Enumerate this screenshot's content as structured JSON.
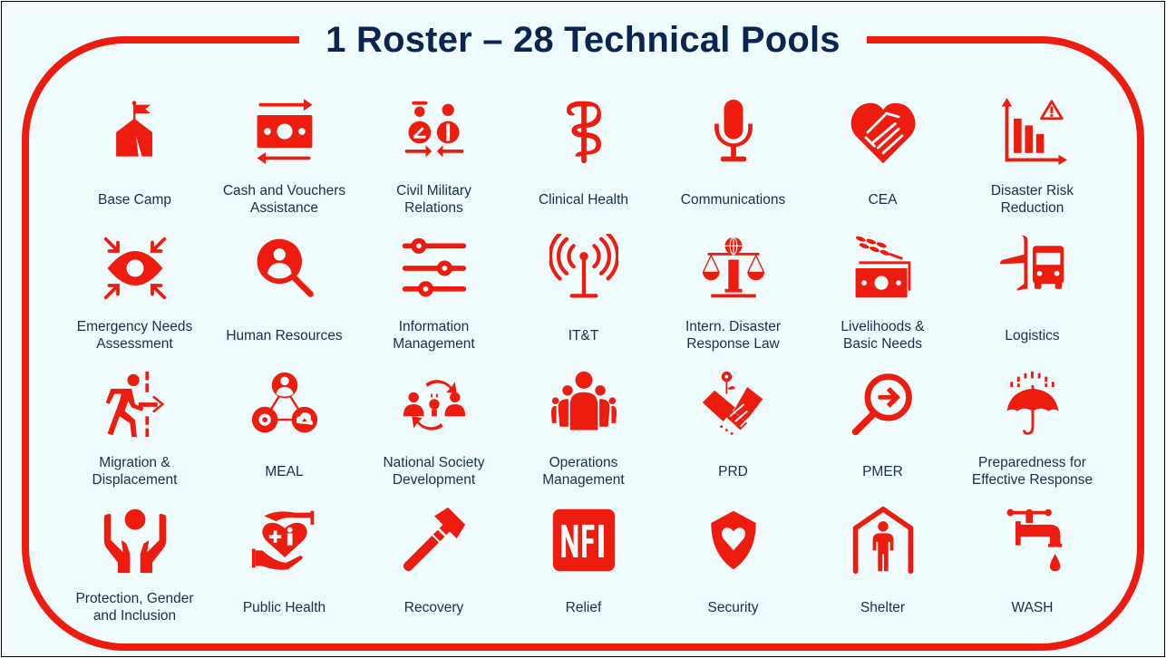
{
  "title": "1 Roster – 28 Technical Pools",
  "colors": {
    "accent": "#EE1C0E",
    "title": "#0C2550",
    "label": "#1B2D4F",
    "background": "#F0FCFE"
  },
  "pools": [
    {
      "label": "Base Camp",
      "icon": "tent-flag-icon"
    },
    {
      "label": "Cash and Vouchers\nAssistance",
      "icon": "cash-transfer-icon"
    },
    {
      "label": "Civil Military\nRelations",
      "icon": "civil-military-icon"
    },
    {
      "label": "Clinical Health",
      "icon": "caduceus-icon"
    },
    {
      "label": "Communications",
      "icon": "microphone-icon"
    },
    {
      "label": "CEA",
      "icon": "heart-handshake-icon"
    },
    {
      "label": "Disaster Risk\nReduction",
      "icon": "chart-warning-icon"
    },
    {
      "label": "Emergency Needs\nAssessment",
      "icon": "eye-focus-icon"
    },
    {
      "label": "Human  Resources",
      "icon": "person-search-icon"
    },
    {
      "label": "Information\nManagement",
      "icon": "sliders-icon"
    },
    {
      "label": "IT&T",
      "icon": "antenna-icon"
    },
    {
      "label": "Intern.  Disaster\nResponse Law",
      "icon": "scales-globe-icon"
    },
    {
      "label": "Livelihoods &\nBasic Needs",
      "icon": "wheat-money-icon"
    },
    {
      "label": "Logistics",
      "icon": "plane-truck-icon"
    },
    {
      "label": "Migration &\nDisplacement",
      "icon": "person-crossing-icon"
    },
    {
      "label": "MEAL",
      "icon": "meal-network-icon"
    },
    {
      "label": "National Society\nDevelopment",
      "icon": "people-idea-icon"
    },
    {
      "label": "Operations\nManagement",
      "icon": "group-people-icon"
    },
    {
      "label": "PRD",
      "icon": "handshake-flower-icon"
    },
    {
      "label": "PMER",
      "icon": "magnifier-arrow-icon"
    },
    {
      "label": "Preparedness for\nEffective Response",
      "icon": "umbrella-rain-icon"
    },
    {
      "label": "Protection, Gender\nand Inclusion",
      "icon": "hands-person-icon"
    },
    {
      "label": "Public Health",
      "icon": "hand-heart-icon"
    },
    {
      "label": "Recovery",
      "icon": "hammer-icon"
    },
    {
      "label": "Relief",
      "icon": "nfi-icon"
    },
    {
      "label": "Security",
      "icon": "shield-heart-icon"
    },
    {
      "label": "Shelter",
      "icon": "house-person-icon"
    },
    {
      "label": "WASH",
      "icon": "tap-drop-icon"
    }
  ]
}
